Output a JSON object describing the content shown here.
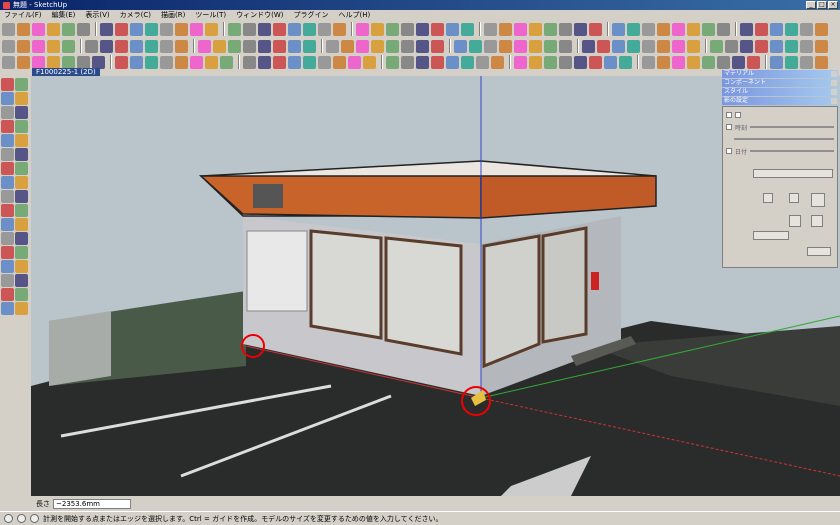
{
  "window": {
    "title": "無題 - SketchUp"
  },
  "menu": [
    "ファイル(F)",
    "編集(E)",
    "表示(V)",
    "カメラ(C)",
    "描画(R)",
    "ツール(T)",
    "ウィンドウ(W)",
    "プラグイン",
    "ヘルプ(H)"
  ],
  "scene_tab": "F1000225-1 (2D)",
  "trays": {
    "titles": [
      "マテリアル",
      "コンポーネント",
      "スタイル",
      "影の設定"
    ],
    "shadow": {
      "time_label": "時刻",
      "date_label": "日付"
    }
  },
  "measurements": {
    "label": "長さ",
    "value": "~2353.6mm"
  },
  "status": {
    "text": "計測を開始する点またはエッジを選択します。Ctrl = ガイドを作成。モデルのサイズを変更するための値を入力してください。"
  },
  "colors": {
    "accent_red": "#cc0000",
    "roof_orange": "#c8642a"
  }
}
